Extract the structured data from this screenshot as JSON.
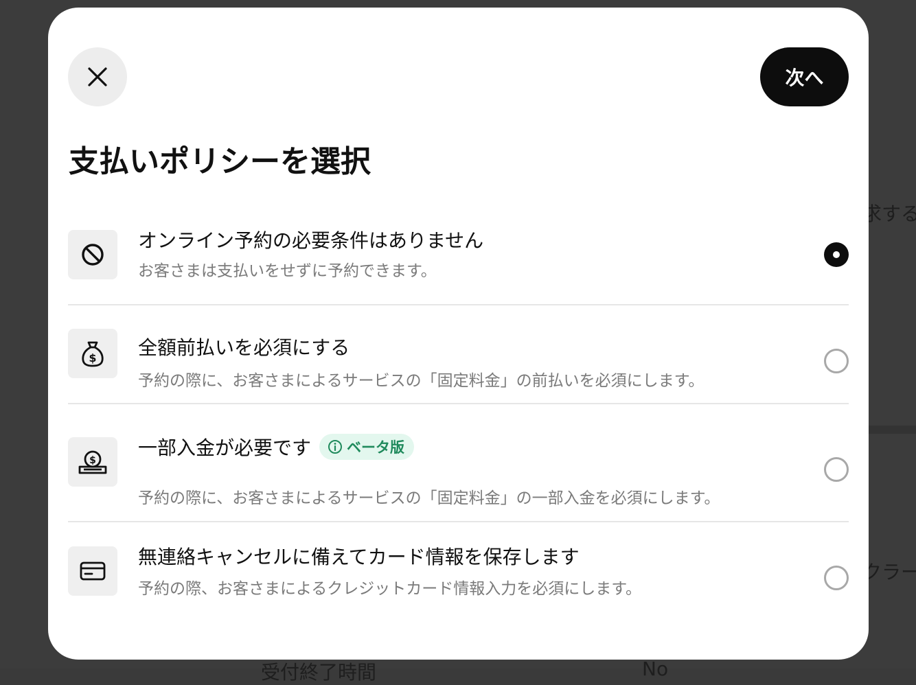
{
  "background": {
    "text_right_top": "求する",
    "text_right_bottom": "クラー",
    "text_bottom_left": "受付終了時間",
    "text_bottom_mid": "No"
  },
  "modal": {
    "next_label": "次へ",
    "title": "支払いポリシーを選択"
  },
  "options": [
    {
      "icon": "prohibited-icon",
      "title": "オンライン予約の必要条件はありません",
      "description": "お客さまは支払いをせずに予約できます。",
      "selected": true
    },
    {
      "icon": "money-bag-icon",
      "title": "全額前払いを必須にする",
      "description": "予約の際に、お客さまによるサービスの「固定料金」の前払いを必須にします。",
      "selected": false
    },
    {
      "icon": "coin-slot-icon",
      "title": "一部入金が必要です",
      "badge": "ベータ版",
      "description": "予約の際に、お客さまによるサービスの「固定料金」の一部入金を必須にします。",
      "selected": false
    },
    {
      "icon": "credit-card-icon",
      "title": "無連絡キャンセルに備えてカード情報を保存します",
      "description": "予約の際、お客さまによるクレジットカード情報入力を必須にします。",
      "selected": false
    }
  ],
  "colors": {
    "primary": "#0d0d0d",
    "badge_bg": "#e3f7ee",
    "badge_text": "#1f8a5c"
  }
}
